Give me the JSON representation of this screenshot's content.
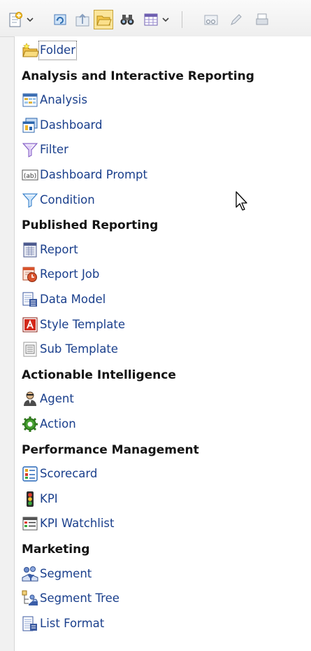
{
  "toolbar": {
    "buttons": [
      {
        "icon": "new-document-icon",
        "dropdown": true
      },
      {
        "icon": "refresh-icon",
        "dropdown": false
      },
      {
        "icon": "upload-icon",
        "dropdown": false
      },
      {
        "icon": "open-folder-icon",
        "dropdown": false,
        "pressed": true
      },
      {
        "icon": "binoculars-icon",
        "dropdown": false
      },
      {
        "icon": "grid-view-icon",
        "dropdown": true
      },
      {
        "icon": "properties-icon",
        "dropdown": false
      },
      {
        "icon": "edit-pencil-icon",
        "dropdown": false
      },
      {
        "icon": "print-icon",
        "dropdown": false
      }
    ]
  },
  "menu": {
    "folder": {
      "label": "Folder",
      "icon": "new-folder-icon"
    },
    "sections": [
      {
        "title": "Analysis and Interactive Reporting",
        "items": [
          {
            "label": "Analysis",
            "icon": "analysis-icon"
          },
          {
            "label": "Dashboard",
            "icon": "dashboard-icon"
          },
          {
            "label": "Filter",
            "icon": "filter-icon"
          },
          {
            "label": "Dashboard Prompt",
            "icon": "dashboard-prompt-icon"
          },
          {
            "label": "Condition",
            "icon": "condition-icon"
          }
        ]
      },
      {
        "title": "Published Reporting",
        "items": [
          {
            "label": "Report",
            "icon": "report-icon"
          },
          {
            "label": "Report Job",
            "icon": "report-job-icon"
          },
          {
            "label": "Data Model",
            "icon": "data-model-icon"
          },
          {
            "label": "Style Template",
            "icon": "style-template-icon"
          },
          {
            "label": "Sub Template",
            "icon": "sub-template-icon"
          }
        ]
      },
      {
        "title": "Actionable Intelligence",
        "items": [
          {
            "label": "Agent",
            "icon": "agent-icon"
          },
          {
            "label": "Action",
            "icon": "action-icon"
          }
        ]
      },
      {
        "title": "Performance Management",
        "items": [
          {
            "label": "Scorecard",
            "icon": "scorecard-icon"
          },
          {
            "label": "KPI",
            "icon": "kpi-icon"
          },
          {
            "label": "KPI Watchlist",
            "icon": "kpi-watchlist-icon"
          }
        ]
      },
      {
        "title": "Marketing",
        "items": [
          {
            "label": "Segment",
            "icon": "segment-icon"
          },
          {
            "label": "Segment Tree",
            "icon": "segment-tree-icon"
          },
          {
            "label": "List Format",
            "icon": "list-format-icon"
          }
        ]
      }
    ]
  },
  "colors": {
    "link": "#1a3f8c",
    "header": "#141414",
    "background": "#ffffff",
    "toolbar": "#eeeeee"
  },
  "cursor": {
    "icon": "mouse-pointer-icon"
  }
}
